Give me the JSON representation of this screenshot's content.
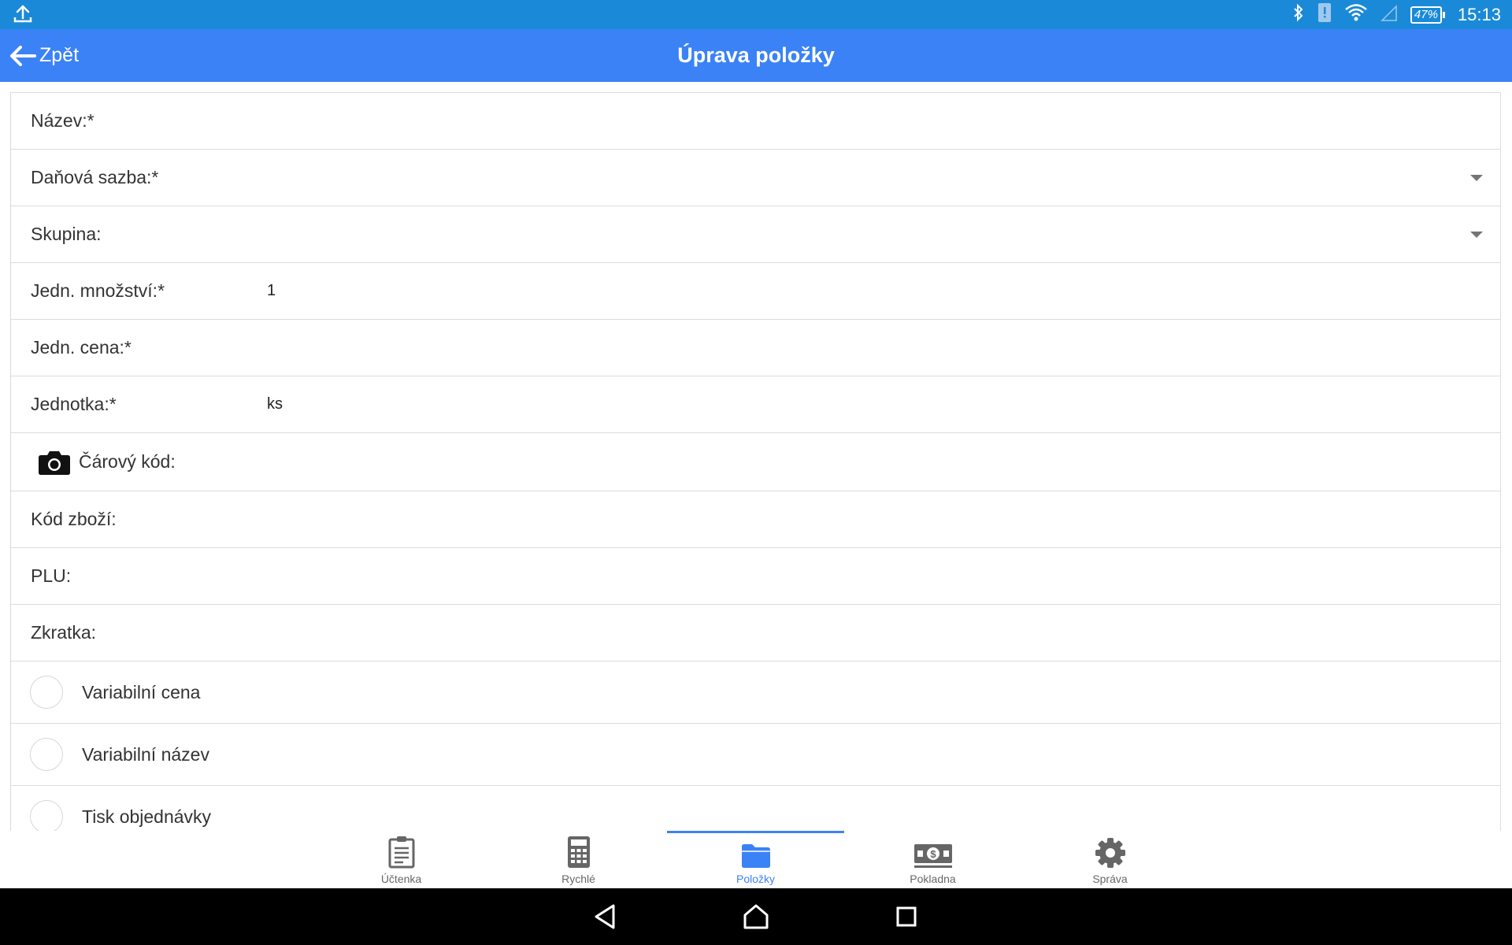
{
  "status_bar": {
    "battery": "47%",
    "time": "15:13"
  },
  "app_bar": {
    "back_label": "Zpět",
    "title": "Úprava položky"
  },
  "form": {
    "name_label": "Název:*",
    "name_value": "",
    "tax_rate_label": "Daňová sazba:*",
    "tax_rate_value": "",
    "group_label": "Skupina:",
    "group_value": "",
    "unit_quantity_label": "Jedn. množství:*",
    "unit_quantity_value": "1",
    "unit_price_label": "Jedn. cena:*",
    "unit_price_value": "",
    "unit_label": "Jednotka:*",
    "unit_value": "ks",
    "barcode_label": "Čárový kód:",
    "barcode_value": "",
    "product_code_label": "Kód zboží:",
    "product_code_value": "",
    "plu_label": "PLU:",
    "plu_value": "",
    "shortcut_label": "Zkratka:",
    "shortcut_value": "",
    "variable_price_label": "Variabilní cena",
    "variable_price_checked": false,
    "variable_name_label": "Variabilní název",
    "variable_name_checked": false,
    "print_order_label": "Tisk objednávky",
    "print_order_checked": false
  },
  "bottom_nav": {
    "items": [
      {
        "label": "Účtenka",
        "icon": "receipt-icon",
        "active": false
      },
      {
        "label": "Rychlé",
        "icon": "calculator-icon",
        "active": false
      },
      {
        "label": "Položky",
        "icon": "folder-icon",
        "active": true
      },
      {
        "label": "Pokladna",
        "icon": "cash-icon",
        "active": false
      },
      {
        "label": "Správa",
        "icon": "gear-icon",
        "active": false
      }
    ]
  },
  "colors": {
    "status_bar": "#1a8ad8",
    "app_bar": "#3b82f6",
    "accent": "#3b82f6",
    "divider": "#dcdcdc"
  }
}
